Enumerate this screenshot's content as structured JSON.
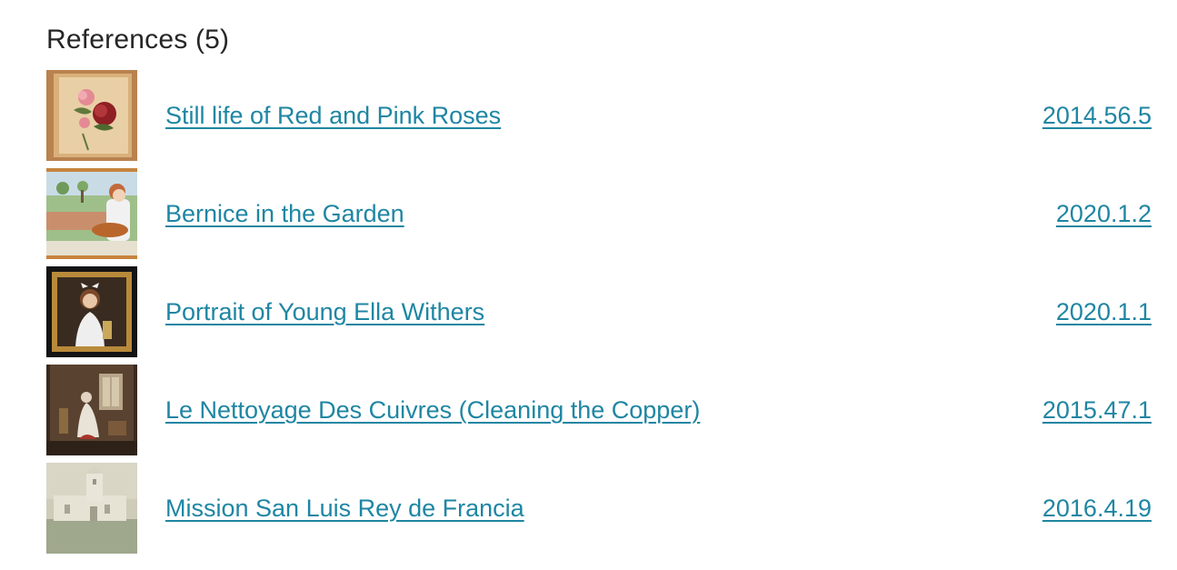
{
  "section": {
    "heading": "References (5)"
  },
  "references": [
    {
      "title": "Still life of Red and Pink Roses",
      "accession": "2014.56.5",
      "thumbnail_icon": "roses-painting-thumbnail"
    },
    {
      "title": "Bernice in the Garden",
      "accession": "2020.1.2",
      "thumbnail_icon": "garden-painting-thumbnail"
    },
    {
      "title": "Portrait of Young Ella Withers",
      "accession": "2020.1.1",
      "thumbnail_icon": "portrait-painting-thumbnail"
    },
    {
      "title": "Le Nettoyage Des Cuivres (Cleaning the Copper)",
      "accession": "2015.47.1",
      "thumbnail_icon": "interior-painting-thumbnail"
    },
    {
      "title": "Mission San Luis Rey de Francia",
      "accession": "2016.4.19",
      "thumbnail_icon": "mission-painting-thumbnail"
    }
  ],
  "colors": {
    "link": "#1f86a3",
    "heading": "#262626",
    "background": "#ffffff"
  }
}
